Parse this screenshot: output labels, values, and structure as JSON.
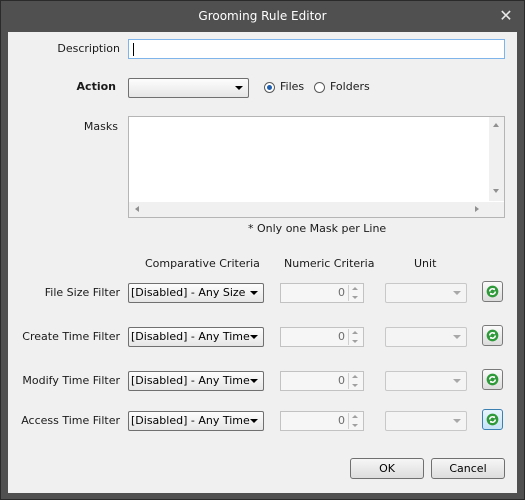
{
  "window": {
    "title": "Grooming Rule Editor",
    "close_glyph": "✕"
  },
  "form": {
    "description_label": "Description",
    "description_value": "",
    "action_label": "Action",
    "action_value": "",
    "target": {
      "files_label": "Files",
      "folders_label": "Folders",
      "selected": "Files"
    },
    "masks_label": "Masks",
    "masks_value": "",
    "masks_note": "* Only one Mask per Line"
  },
  "filters": {
    "headers": {
      "criteria": "Comparative Criteria",
      "numeric": "Numeric Criteria",
      "unit": "Unit"
    },
    "rows": [
      {
        "label": "File Size Filter",
        "criteria": "[Disabled] - Any Size",
        "numeric": "0",
        "unit": ""
      },
      {
        "label": "Create Time Filter",
        "criteria": "[Disabled] - Any Time",
        "numeric": "0",
        "unit": ""
      },
      {
        "label": "Modify Time Filter",
        "criteria": "[Disabled] - Any Time",
        "numeric": "0",
        "unit": ""
      },
      {
        "label": "Access Time Filter",
        "criteria": "[Disabled] - Any Time",
        "numeric": "0",
        "unit": ""
      }
    ]
  },
  "buttons": {
    "ok": "OK",
    "cancel": "Cancel"
  },
  "icons": {
    "refresh": "refresh-icon",
    "close": "close-icon",
    "combo_arrow": "chevron-down-icon"
  },
  "colors": {
    "titlebar": "#505050",
    "client": "#f0f0f0",
    "refresh_green": "#2f9a3a",
    "focus_border": "#7eb4ea"
  }
}
